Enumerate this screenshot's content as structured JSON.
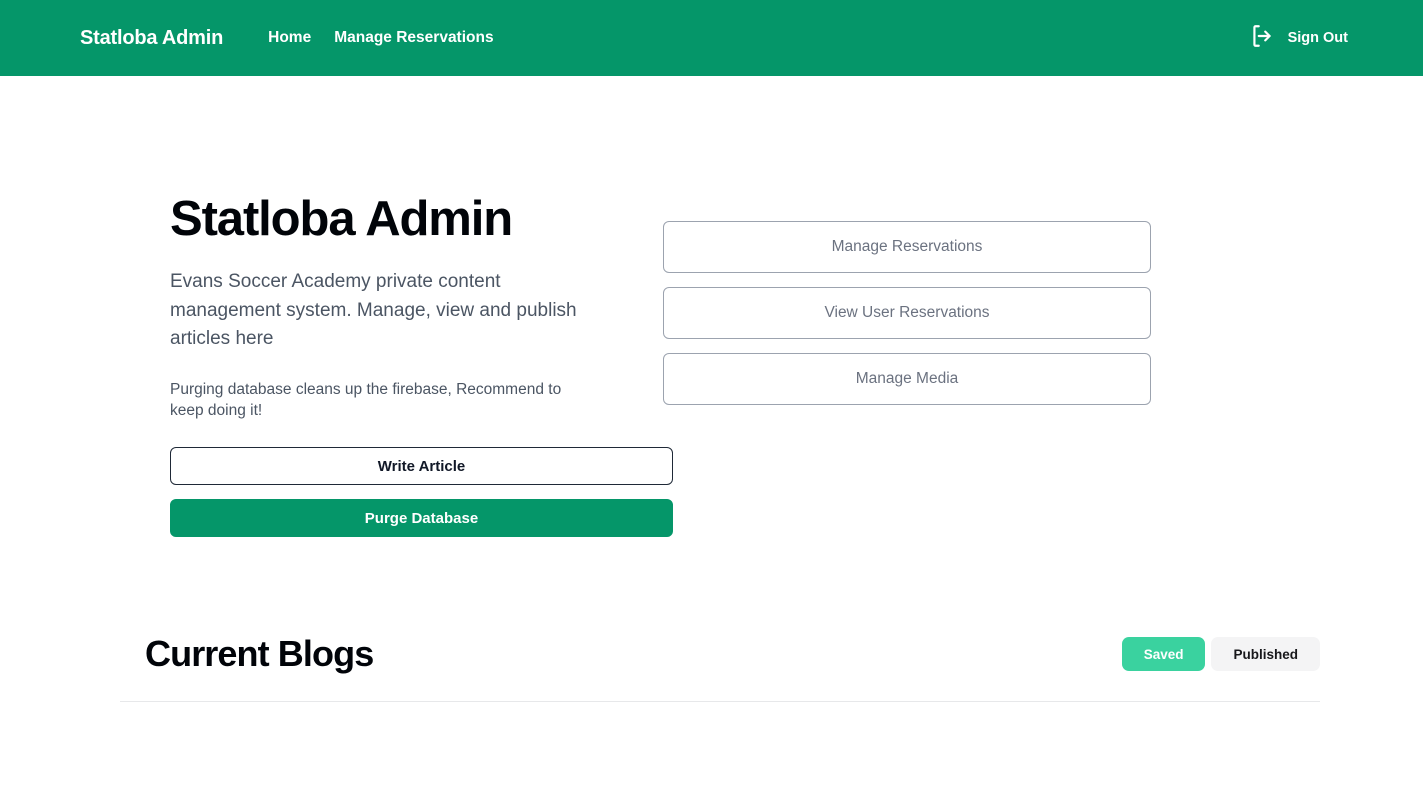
{
  "navbar": {
    "brand": "Statloba Admin",
    "links": [
      {
        "label": "Home",
        "name": "nav-link-home"
      },
      {
        "label": "Manage Reservations",
        "name": "nav-link-manage-reservations"
      }
    ],
    "signout_label": "Sign Out",
    "signout_icon": "logout-icon",
    "background_color": "#059669",
    "text_color": "#ffffff"
  },
  "hero": {
    "title": "Statloba Admin",
    "subtitle": "Evans Soccer Academy private content management system. Manage, view and publish articles here",
    "note": "Purging database cleans up the firebase, Recommend to keep doing it!",
    "primary_actions": [
      {
        "label": "Write Article",
        "style": "outline-dark"
      },
      {
        "label": "Purge Database",
        "style": "solid-green"
      }
    ],
    "side_actions": [
      {
        "label": "Manage Reservations"
      },
      {
        "label": "View User Reservations"
      },
      {
        "label": "Manage Media"
      }
    ]
  },
  "blogs": {
    "title": "Current Blogs",
    "filters": [
      {
        "label": "Saved",
        "active": true
      },
      {
        "label": "Published",
        "active": false
      }
    ],
    "items": []
  },
  "colors": {
    "brand_green": "#059669",
    "accent_mint": "#3ad29f",
    "pill_idle_bg": "#f4f4f5",
    "border_dark": "#1f2937",
    "border_grey": "#9ca3af",
    "text_muted": "#4b5563",
    "divider": "#e7e8ea"
  }
}
